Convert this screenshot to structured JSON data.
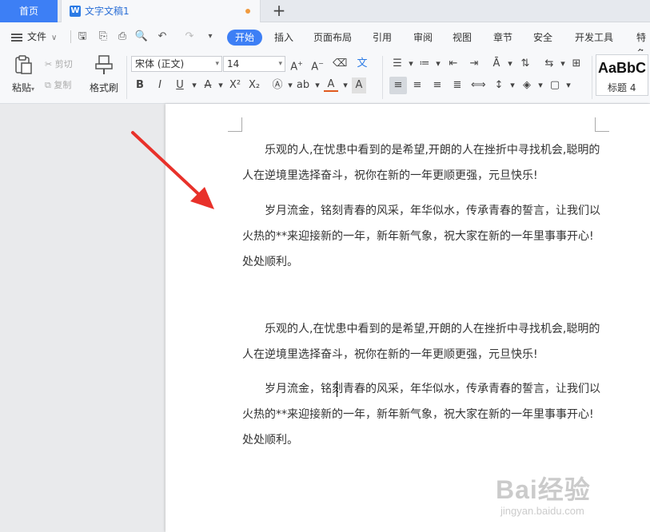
{
  "tabbar": {
    "home_label": "首页",
    "doc_tab_title": "文字文稿1",
    "add_label": "+"
  },
  "menubar": {
    "file_label": "文件",
    "items": [
      "开始",
      "插入",
      "页面布局",
      "引用",
      "审阅",
      "视图",
      "章节",
      "安全",
      "开发工具",
      "特色"
    ],
    "active_index": 0
  },
  "ribbon": {
    "paste_label": "粘贴",
    "cut_label": "剪切",
    "copy_label": "复制",
    "format_painter_label": "格式刷",
    "font_name": "宋体 (正文)",
    "font_size": "14",
    "style_preview": "AaBbC",
    "style_name": "标题 4"
  },
  "document": {
    "paragraphs": [
      "乐观的人,在忧患中看到的是希望,开朗的人在挫折中寻找机会,聪明的人在逆境里选择奋斗，祝你在新的一年更顺更强，元旦快乐!",
      "岁月流金，铭刻青春的风采，年华似水，传承青春的誓言，让我们以火热的**来迎接新的一年，新年新气象，祝大家在新的一年里事事开心!处处顺利。",
      "乐观的人,在忧患中看到的是希望,开朗的人在挫折中寻找机会,聪明的人在逆境里选择奋斗，祝你在新的一年更顺更强，元旦快乐!",
      "岁月流金，铭刻青春的风采，年华似水，传承青春的誓言，让我们以火热的**来迎接新的一年，新年新气象，祝大家在新的一年里事事开心!处处顺利。"
    ]
  },
  "watermark": {
    "main": "Bai经验",
    "sub": "jingyan.baidu.com"
  },
  "colors": {
    "accent": "#3d7ff5",
    "arrow": "#e8312a"
  }
}
